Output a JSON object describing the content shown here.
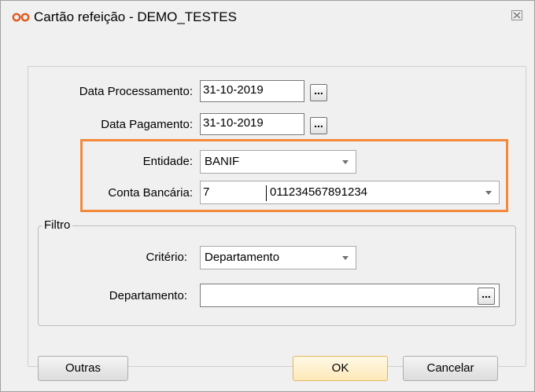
{
  "window": {
    "title": "Cartão refeição - DEMO_TESTES",
    "icon": "infinity-icon",
    "close_icon": "close-icon"
  },
  "form": {
    "data_processamento": {
      "label": "Data Processamento:",
      "value": "31-10-2019",
      "button": "..."
    },
    "data_pagamento": {
      "label": "Data Pagamento:",
      "value": "31-10-2019",
      "button": "..."
    },
    "entidade": {
      "label": "Entidade:",
      "value": "BANIF"
    },
    "conta_bancaria": {
      "label": "Conta Bancária:",
      "code": "7",
      "number": "011234567891234"
    }
  },
  "filtro": {
    "legend": "Filtro",
    "criterio": {
      "label": "Critério:",
      "value": "Departamento"
    },
    "departamento": {
      "label": "Departamento:",
      "value": "",
      "button": "..."
    }
  },
  "buttons": {
    "outras": "Outras",
    "ok": "OK",
    "cancelar": "Cancelar"
  },
  "colors": {
    "highlight": "#f5893b",
    "window_bg": "#f0f0f0",
    "default_button_border": "#e3b65a"
  }
}
